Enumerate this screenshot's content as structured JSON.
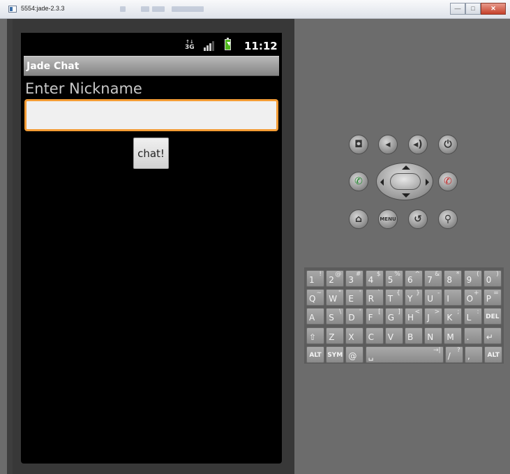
{
  "window": {
    "title": "5554:jade-2.3.3",
    "buttons": [
      "—",
      "□",
      "✕"
    ]
  },
  "device": {
    "status_bar": {
      "network": "3G",
      "time": "11:12"
    },
    "app_title": "Jade Chat",
    "nickname_label": "Enter Nickname",
    "nickname_value": "",
    "chat_button": "chat!"
  },
  "controls": {
    "row1": [
      {
        "name": "camera-button",
        "icon": "camera-icon",
        "glyph": "◘"
      },
      {
        "name": "volume-down-button",
        "icon": "volume-down-icon",
        "glyph": "◂"
      },
      {
        "name": "volume-up-button",
        "icon": "volume-up-icon",
        "glyph": "◂)"
      },
      {
        "name": "power-button",
        "icon": "power-icon",
        "glyph": "⏻"
      }
    ],
    "row2": [
      {
        "name": "call-button",
        "icon": "call-icon",
        "glyph": "✆",
        "color": "#1f8a2c"
      },
      {
        "name": "end-call-button",
        "icon": "end-call-icon",
        "glyph": "✆",
        "color": "#c62828"
      }
    ],
    "row3": [
      {
        "name": "home-button",
        "icon": "home-icon",
        "glyph": "⌂"
      },
      {
        "name": "menu-button",
        "icon": "menu-icon",
        "glyph": "MENU"
      },
      {
        "name": "back-button",
        "icon": "back-icon",
        "glyph": "↺"
      },
      {
        "name": "search-button",
        "icon": "search-icon",
        "glyph": "⚲"
      }
    ]
  },
  "keyboard": {
    "rows": [
      [
        [
          "1",
          "!"
        ],
        [
          "2",
          "@"
        ],
        [
          "3",
          "#"
        ],
        [
          "4",
          "$"
        ],
        [
          "5",
          "%"
        ],
        [
          "6",
          "^"
        ],
        [
          "7",
          "&"
        ],
        [
          "8",
          "*"
        ],
        [
          "9",
          "("
        ],
        [
          "0",
          ")"
        ]
      ],
      [
        [
          "Q",
          "~"
        ],
        [
          "W",
          "\""
        ],
        [
          "E",
          "'"
        ],
        [
          "R",
          "`"
        ],
        [
          "T",
          "{"
        ],
        [
          "Y",
          "}"
        ],
        [
          "U",
          "-"
        ],
        [
          "I",
          ""
        ],
        [
          "O",
          "+"
        ],
        [
          "P",
          "="
        ]
      ],
      [
        [
          "A",
          ""
        ],
        [
          "S",
          "\\"
        ],
        [
          "D",
          "'"
        ],
        [
          "F",
          "["
        ],
        [
          "G",
          "]"
        ],
        [
          "H",
          "<"
        ],
        [
          "J",
          ">"
        ],
        [
          "K",
          ";"
        ],
        [
          "L",
          ":"
        ],
        [
          "DEL",
          ""
        ]
      ],
      [
        [
          "⇧",
          ""
        ],
        [
          "Z",
          ""
        ],
        [
          "X",
          ""
        ],
        [
          "C",
          ""
        ],
        [
          "V",
          ""
        ],
        [
          "B",
          ""
        ],
        [
          "N",
          ""
        ],
        [
          "M",
          ""
        ],
        [
          ".",
          ""
        ],
        [
          "↵",
          ""
        ]
      ],
      [
        [
          "ALT",
          ""
        ],
        [
          "SYM",
          ""
        ],
        [
          "@",
          ""
        ],
        [
          "␣",
          "→|"
        ],
        [
          "/",
          "?"
        ],
        [
          ",",
          ""
        ],
        [
          "ALT",
          ""
        ]
      ]
    ]
  }
}
